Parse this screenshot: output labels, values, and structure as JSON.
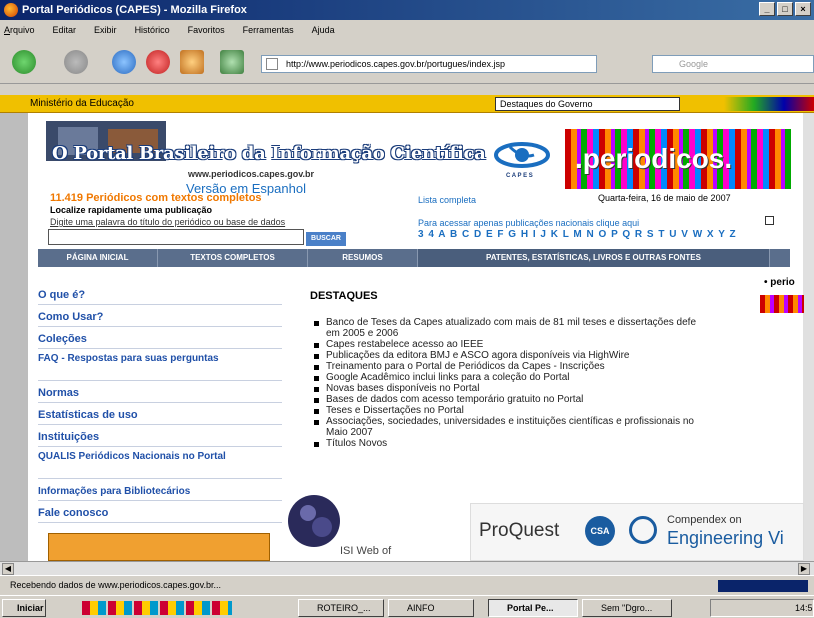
{
  "window": {
    "title": "Portal Periódicos (CAPES) - Mozilla Firefox"
  },
  "menu": [
    "Arquivo",
    "Editar",
    "Exibir",
    "Histórico",
    "Favoritos",
    "Ferramentas",
    "Ajuda"
  ],
  "nav": {
    "url": "http://www.periodicos.capes.gov.br/portugues/index.jsp",
    "search_placeholder": "Google"
  },
  "govbar": {
    "ministry": "Ministério da Educação",
    "select_value": "Destaques do Governo"
  },
  "header": {
    "portal_title": "O Portal Brasileiro da Informação Científica",
    "portal_url": "www.periodicos.capes.gov.br",
    "spanish_link": "Versão em Espanhol",
    "capes_label": "C A P E S",
    "periodicos_label": ".periodicos."
  },
  "search": {
    "count_text": "11.419 Periódicos com textos completos",
    "localize": "Localize rapidamente uma publicação",
    "digite": "Digite uma palavra do título do periódico ou base de dados",
    "ok_label": "BUSCAR",
    "lista": "Lista completa",
    "date": "Quarta-feira, 16 de maio de 2007",
    "para_acessar": "Para acessar apenas publicações nacionais clique aqui",
    "letters": "3 4 A B C D E F G H I J K L M N O P Q R S T U V W X Y Z"
  },
  "tabs": [
    "PÁGINA INICIAL",
    "TEXTOS COMPLETOS",
    "RESUMOS",
    "PATENTES, ESTATÍSTICAS, LIVROS E OUTRAS FONTES"
  ],
  "leftnav": [
    "O que é?",
    "Como Usar?",
    "Coleções",
    "FAQ - Respostas para suas perguntas",
    "Normas",
    "Estatísticas de uso",
    "Instituições",
    "QUALIS Periódicos Nacionais no Portal",
    "Informações para Bibliotecários",
    "Fale conosco"
  ],
  "main": {
    "heading": "DESTAQUES",
    "items": [
      "Banco de Teses da Capes atualizado com mais de 81 mil teses e dissertações defe",
      "em 2005 e 2006",
      "Capes restabelece acesso ao IEEE",
      "Publicações da editora BMJ e ASCO agora disponíveis via HighWire",
      "Treinamento para o Portal de Periódicos da Capes - Inscrições",
      "Google Acadêmico inclui links para a coleção do Portal",
      "Novas bases disponíveis no Portal",
      "Bases de dados com acesso temporário gratuito no Portal",
      "Teses e Dissertações no Portal",
      "Associações, sociedades, universidades e instituições científicas e profissionais no",
      "Maio 2007",
      "Títulos Novos"
    ],
    "chip_label": "• perio",
    "isi_label": "ISI Web of",
    "proquest": "ProQuest",
    "csa": "CSA",
    "compendex_on": "Compendex on",
    "engineering": "Engineering Vi"
  },
  "status": {
    "text": "Recebendo dados de www.periodicos.capes.gov.br..."
  },
  "taskbar": {
    "start": "Iniciar",
    "buttons": [
      "ROTEIRO_...",
      "AINFO",
      "Portal Pe...",
      "Sem \"Dgro..."
    ],
    "clock": "14:5"
  }
}
